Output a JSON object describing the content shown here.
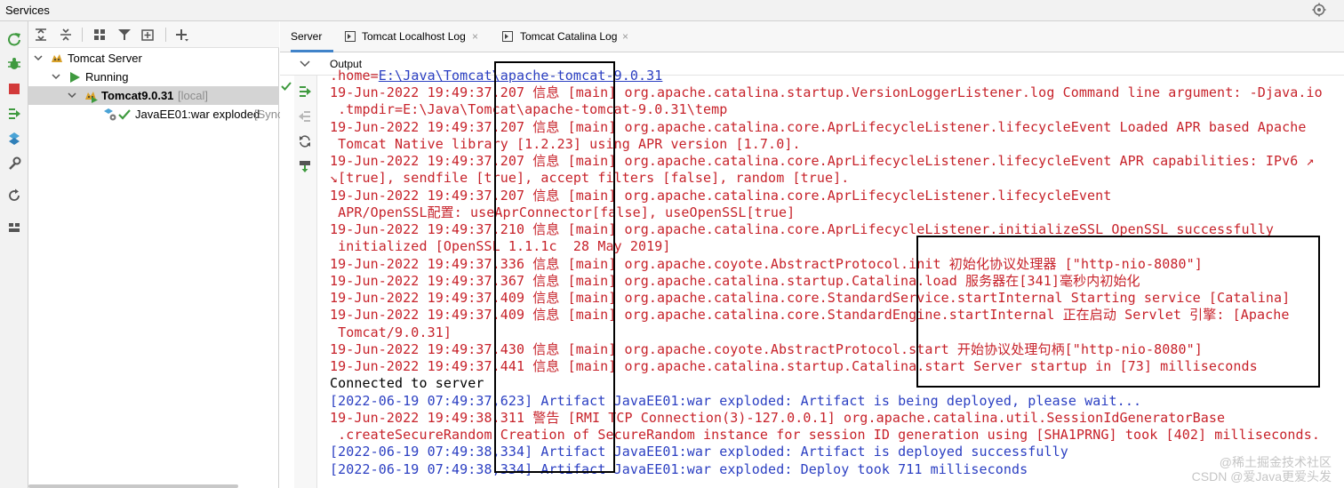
{
  "window": {
    "title": "Services"
  },
  "tree": {
    "rows": [
      {
        "label": "Tomcat Server"
      },
      {
        "label": "Running"
      },
      {
        "label": "Tomcat9.0.31",
        "tag": "[local]"
      },
      {
        "label": "JavaEE01:war exploded",
        "tag": "[Sync"
      }
    ]
  },
  "tabs": [
    {
      "label": "Server",
      "active": true
    },
    {
      "label": "Tomcat Localhost Log",
      "close": "×"
    },
    {
      "label": "Tomcat Catalina Log",
      "close": "×"
    }
  ],
  "output": {
    "label": "Output",
    "lines": [
      {
        "text": ".home=",
        "link": "E:\\Java\\Tomcat\\apache-tomcat-9.0.31",
        "color": "red"
      },
      {
        "text": "19-Jun-2022 19:49:37.207 信息 [main] org.apache.catalina.startup.VersionLoggerListener.log Command line argument: -Djava.io",
        "color": "red"
      },
      {
        "text": " .tmpdir=E:\\Java\\Tomcat\\apache-tomcat-9.0.31\\temp",
        "color": "red"
      },
      {
        "text": "19-Jun-2022 19:49:37.207 信息 [main] org.apache.catalina.core.AprLifecycleListener.lifecycleEvent Loaded APR based Apache",
        "color": "red"
      },
      {
        "text": " Tomcat Native library [1.2.23] using APR version [1.7.0].",
        "color": "red"
      },
      {
        "text": "19-Jun-2022 19:49:37.207 信息 [main] org.apache.catalina.core.AprLifecycleListener.lifecycleEvent APR capabilities: IPv6 ↗",
        "color": "red"
      },
      {
        "text": "↘[true], sendfile [true], accept filters [false], random [true].",
        "color": "red"
      },
      {
        "text": "19-Jun-2022 19:49:37.207 信息 [main] org.apache.catalina.core.AprLifecycleListener.lifecycleEvent",
        "color": "red"
      },
      {
        "text": " APR/OpenSSL配置: useAprConnector[false], useOpenSSL[true]",
        "color": "red"
      },
      {
        "text": "19-Jun-2022 19:49:37.210 信息 [main] org.apache.catalina.core.AprLifecycleListener.initializeSSL OpenSSL successfully",
        "color": "red"
      },
      {
        "text": " initialized [OpenSSL 1.1.1c  28 May 2019]",
        "color": "red"
      },
      {
        "text": "19-Jun-2022 19:49:37.336 信息 [main] org.apache.coyote.AbstractProtocol.init 初始化协议处理器 [\"http-nio-8080\"]",
        "color": "red"
      },
      {
        "text": "19-Jun-2022 19:49:37.367 信息 [main] org.apache.catalina.startup.Catalina.load 服务器在[341]毫秒内初始化",
        "color": "red"
      },
      {
        "text": "19-Jun-2022 19:49:37.409 信息 [main] org.apache.catalina.core.StandardService.startInternal Starting service [Catalina]",
        "color": "red"
      },
      {
        "text": "19-Jun-2022 19:49:37.409 信息 [main] org.apache.catalina.core.StandardEngine.startInternal 正在启动 Servlet 引擎: [Apache",
        "color": "red"
      },
      {
        "text": " Tomcat/9.0.31]",
        "color": "red"
      },
      {
        "text": "19-Jun-2022 19:49:37.430 信息 [main] org.apache.coyote.AbstractProtocol.start 开始协议处理句柄[\"http-nio-8080\"]",
        "color": "red"
      },
      {
        "text": "19-Jun-2022 19:49:37.441 信息 [main] org.apache.catalina.startup.Catalina.start Server startup in [73] milliseconds",
        "color": "red"
      },
      {
        "text": "Connected to server",
        "color": "black"
      },
      {
        "text": "[2022-06-19 07:49:37,623] Artifact JavaEE01:war exploded: Artifact is being deployed, please wait...",
        "color": "blue"
      },
      {
        "text": "19-Jun-2022 19:49:38.311 警告 [RMI TCP Connection(3)-127.0.0.1] org.apache.catalina.util.SessionIdGeneratorBase",
        "color": "red"
      },
      {
        "text": " .createSecureRandom Creation of SecureRandom instance for session ID generation using [SHA1PRNG] took [402] milliseconds.",
        "color": "red"
      },
      {
        "text": "[2022-06-19 07:49:38,334] Artifact JavaEE01:war exploded: Artifact is deployed successfully",
        "color": "blue"
      },
      {
        "text": "[2022-06-19 07:49:38,334] Artifact JavaEE01:war exploded: Deploy took 711 milliseconds",
        "color": "blue"
      }
    ]
  },
  "watermark": {
    "line1": "@稀土掘金技术社区",
    "line2": "CSDN @爱Java更爱头发"
  },
  "colors": {
    "error_red": "#c7222a",
    "info_blue": "#2b3fc2",
    "run_green": "#3f9a3f",
    "stop_red": "#d23a3a",
    "accent_blue": "#4083c9"
  }
}
